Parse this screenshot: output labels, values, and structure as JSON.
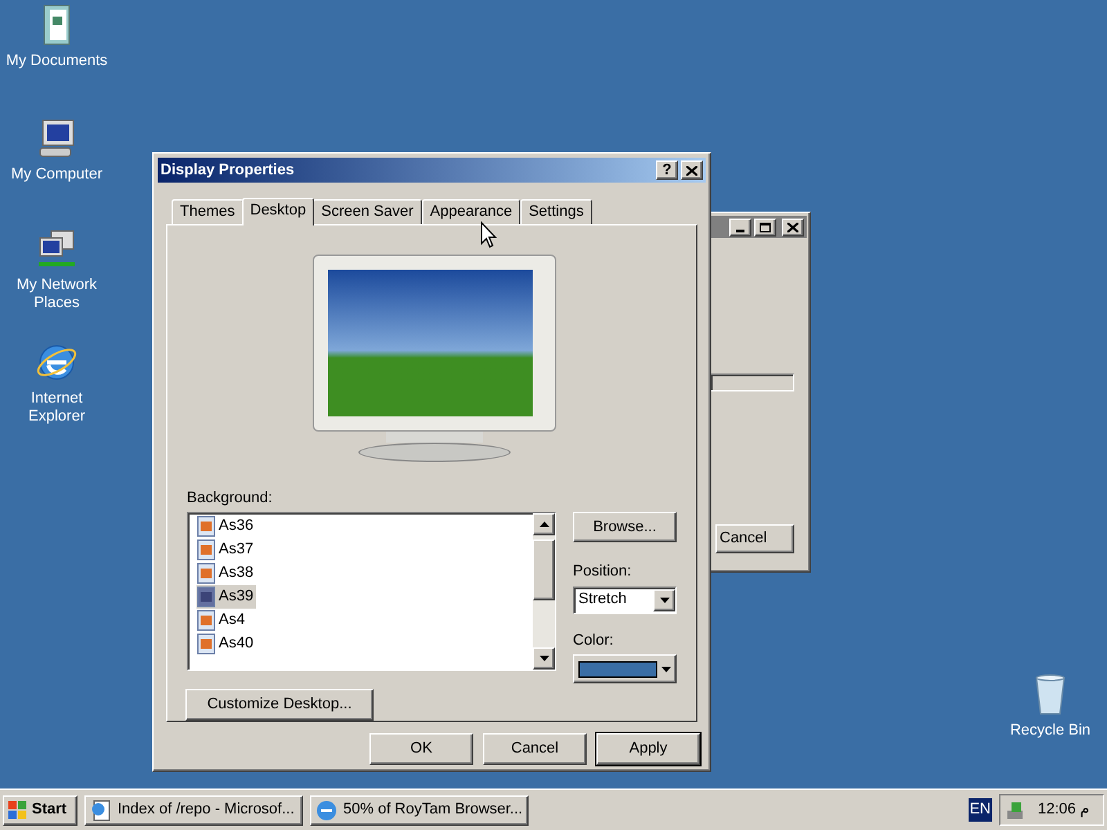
{
  "desktop_icons": [
    {
      "label": "My Documents",
      "kind": "documents"
    },
    {
      "label": "My Computer",
      "kind": "computer"
    },
    {
      "label": "My Network Places",
      "kind": "network"
    },
    {
      "label": "Internet Explorer",
      "kind": "browser"
    },
    {
      "label": "Recycle Bin",
      "kind": "bin"
    }
  ],
  "back_window": {
    "cancel": "Cancel"
  },
  "dialog": {
    "title": "Display Properties",
    "help": "?",
    "tabs": [
      {
        "label": "Themes",
        "selected": false
      },
      {
        "label": "Desktop",
        "selected": true
      },
      {
        "label": "Screen Saver",
        "selected": false
      },
      {
        "label": "Appearance",
        "selected": false
      },
      {
        "label": "Settings",
        "selected": false
      }
    ],
    "background_label": "Background:",
    "backgrounds": [
      {
        "name": "As36",
        "selected": false
      },
      {
        "name": "As37",
        "selected": false
      },
      {
        "name": "As38",
        "selected": false
      },
      {
        "name": "As39",
        "selected": true
      },
      {
        "name": "As4",
        "selected": false
      },
      {
        "name": "As40",
        "selected": false
      }
    ],
    "browse": "Browse...",
    "position_label": "Position:",
    "position": "Stretch",
    "color_label": "Color:",
    "customize": "Customize Desktop...",
    "buttons": [
      {
        "label": "OK",
        "default": false
      },
      {
        "label": "Cancel",
        "default": false
      },
      {
        "label": "Apply",
        "default": true
      }
    ]
  },
  "taskbar": {
    "start": "Start",
    "tasks": [
      {
        "label": "Index of /repo - Microsof...",
        "kind": "page"
      },
      {
        "label": "50% of RoyTam Browser...",
        "kind": "browser"
      }
    ],
    "language": "EN",
    "clock": "12:06 م"
  }
}
